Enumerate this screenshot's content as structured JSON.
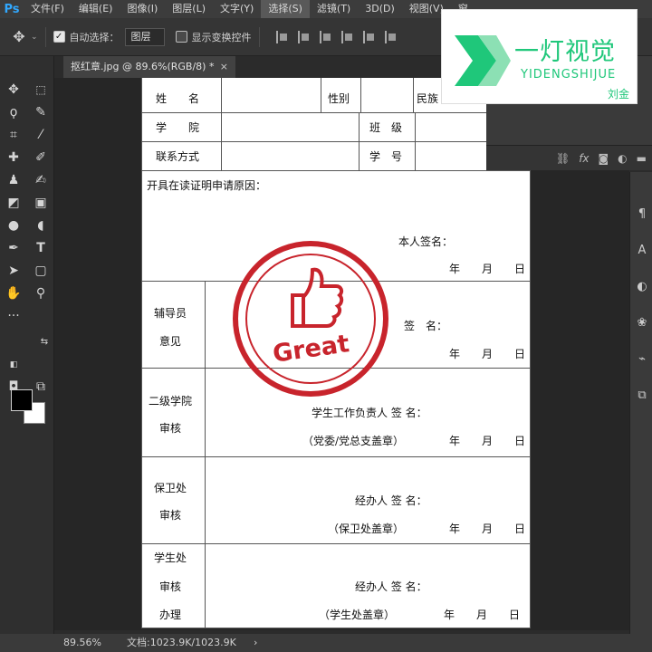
{
  "app": {
    "logo": "Ps"
  },
  "menu": [
    "文件(F)",
    "编辑(E)",
    "图像(I)",
    "图层(L)",
    "文字(Y)",
    "选择(S)",
    "滤镜(T)",
    "3D(D)",
    "视图(V)",
    "窗"
  ],
  "options": {
    "auto_select_label": "自动选择：",
    "auto_select_value": "图层",
    "transform_label": "显示变换控件"
  },
  "tab": {
    "title": "抠红章.jpg @ 89.6%(RGB/8) *",
    "close": "×"
  },
  "form": {
    "name_label": "姓　　名",
    "gender_label": "性别",
    "ethnicity_label": "民族",
    "college_label": "学　　院",
    "class_label": "班　级",
    "phone_label": "联系方式",
    "student_id_label": "学　号",
    "reason_label": "开具在读证明申请原因：",
    "applicant_sign": "本人签名：",
    "date_label": "年　　月　　日",
    "counselor_label_1": "辅导员",
    "counselor_label_2": "意见",
    "counselor_sign": "签　名：",
    "college2_label_1": "二级学院",
    "college2_label_2": "审核",
    "college2_sign": "学生工作负责人 签 名：",
    "college2_seal": "（党委/党总支盖章）",
    "security_label_1": "保卫处",
    "security_label_2": "审核",
    "security_sign": "经办人 签 名：",
    "security_seal": "（保卫处盖章）",
    "student_label_1": "学生处",
    "student_label_2": "审核",
    "student_label_3": "办理",
    "student_sign": "经办人 签 名：",
    "student_seal": "（学生处盖章）"
  },
  "stamp": {
    "text": "Great",
    "color": "#c8242c"
  },
  "watermark": {
    "title": "一灯视觉",
    "subtitle": "YIDENGSHIJUE",
    "author": "刘金",
    "color": "#1fc77a"
  },
  "status": {
    "zoom": "89.56%",
    "doc_info": "文档:1023.9K/1023.9K",
    "arrow": "›"
  }
}
